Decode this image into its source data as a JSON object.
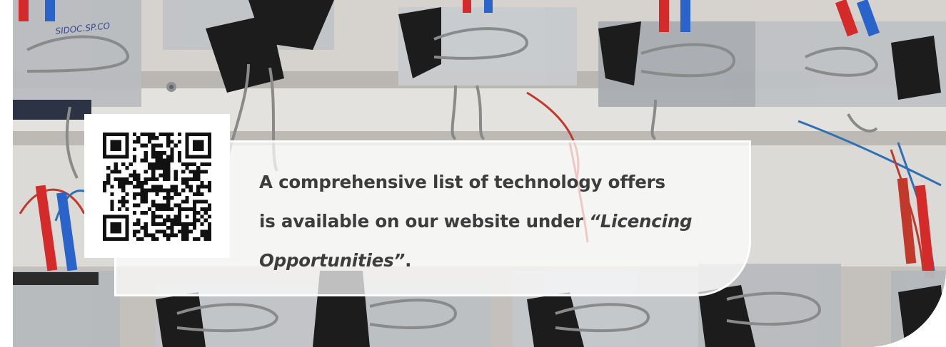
{
  "callout": {
    "text_line1": "A comprehensive list of technology offers",
    "text_line2_prefix": "is available on our website under ",
    "text_line2_quote": "“Licencing",
    "text_line3_quote": "Opportunities”",
    "text_line3_suffix": "."
  },
  "photo": {
    "label_text": "SIDOC.SP.CO"
  },
  "colors": {
    "text": "#3d3d3d",
    "panel_border": "#ffffff"
  }
}
